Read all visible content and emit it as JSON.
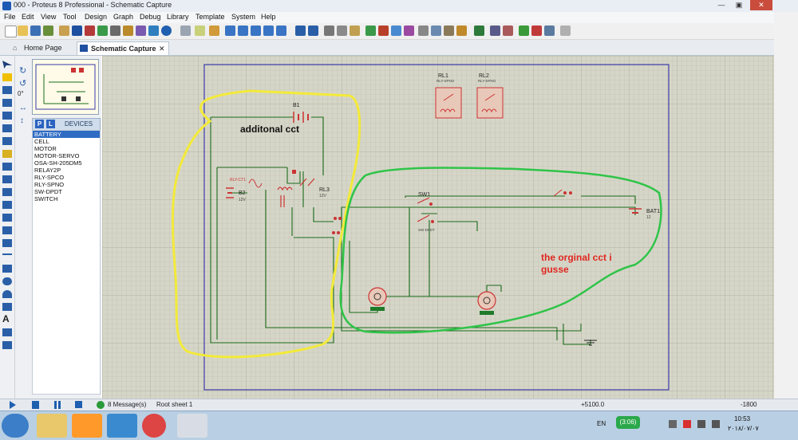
{
  "window": {
    "title": "000 - Proteus 8 Professional - Schematic Capture"
  },
  "menu": [
    "File",
    "Edit",
    "View",
    "Tool",
    "Design",
    "Graph",
    "Debug",
    "Library",
    "Template",
    "System",
    "Help"
  ],
  "tabs": [
    {
      "label": "Home Page"
    },
    {
      "label": "Schematic Capture"
    }
  ],
  "left_panel": {
    "zoom_value": "0°",
    "devices_header": "DEVICES",
    "pick_p": "P",
    "pick_l": "L",
    "devices": [
      "BATTERY",
      "CELL",
      "MOTOR",
      "MOTOR-SERVO",
      "OSA-SH-205DM5",
      "RELAY2P",
      "RLY-SPCO",
      "RLY-SPNO",
      "SW-DPDT",
      "SWITCH"
    ],
    "selected_index": 0
  },
  "schematic": {
    "annotation_yellow": "additonal cct",
    "annotation_red": "the orginal cct i\ngusse",
    "labels": {
      "b1": "B1",
      "b2": "B2",
      "b2v": "12V",
      "rl3": "RL3",
      "rl3v": "12V",
      "rl1": "RL1",
      "rl1t": "RLY-SPNO",
      "rl2": "RL2",
      "rl2t": "RLY-SPNO",
      "sw1": "SW1",
      "sw1t": "SW-DPDT",
      "bat1": "BAT1",
      "bat1v": "12",
      "relay_name": "RLY-CT1"
    }
  },
  "status": {
    "messages": "8 Message(s)",
    "sheet": "Root sheet 1",
    "coord_x": "+5100.0",
    "coord_y": "-1800"
  },
  "taskbar": {
    "lang": "EN",
    "badge": "(3:06)",
    "time": "10:53",
    "date": "٢٠١٨/٠٧/٠٧"
  },
  "colors": {
    "yellow": "#f3ea3a",
    "green": "#2fc448",
    "red": "#e0261f",
    "wire": "#1a6b1a",
    "sheet": "#3a3aa8"
  }
}
